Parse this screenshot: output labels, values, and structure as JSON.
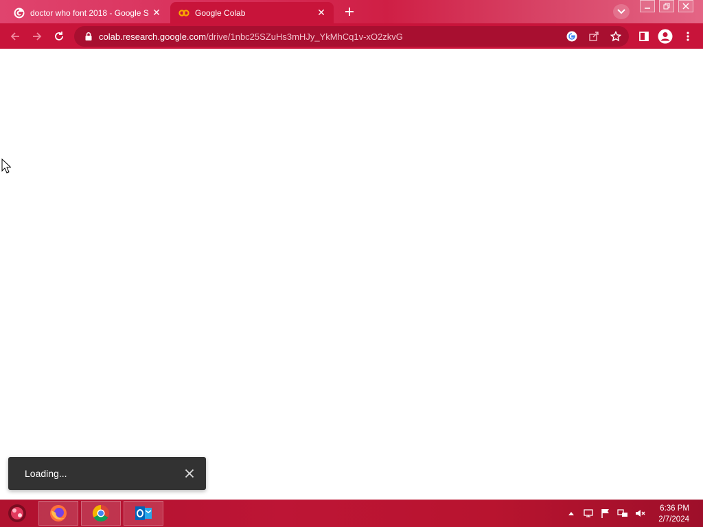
{
  "browser": {
    "tabs": [
      {
        "title": "doctor who font 2018 - Google S",
        "icon": "google-icon",
        "active": false
      },
      {
        "title": "Google Colab",
        "icon": "colab-icon",
        "active": true
      }
    ],
    "url": {
      "host": "colab.research.google.com",
      "path": "/drive/1nbc25SZuHs3mHJy_YkMhCq1v-xO2zkvG"
    },
    "accent": "#c8143a"
  },
  "page": {
    "snackbar": {
      "message": "Loading..."
    }
  },
  "taskbar": {
    "apps": [
      "firefox-icon",
      "chrome-icon",
      "outlook-icon"
    ],
    "clock": {
      "time": "6:36 PM",
      "date": "2/7/2024"
    }
  }
}
